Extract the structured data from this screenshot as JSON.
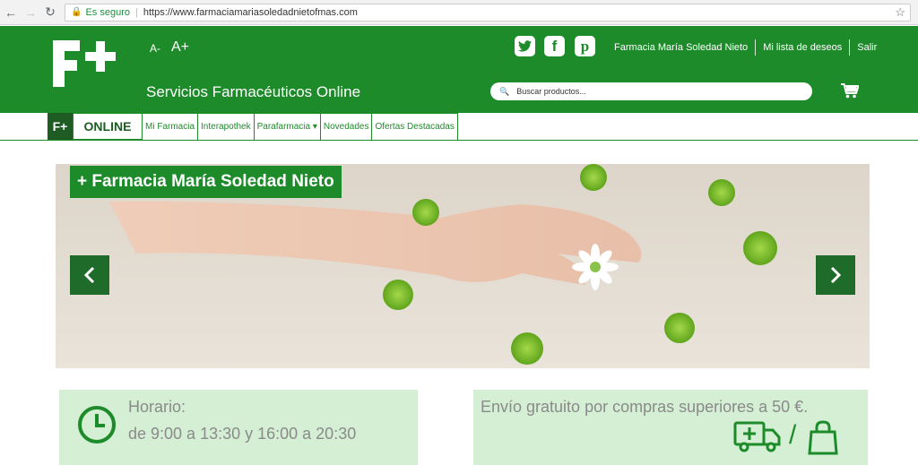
{
  "browser": {
    "secure_label": "Es seguro",
    "url": "https://www.farmaciamariasoledadnietofmas.com"
  },
  "header": {
    "logo_text": "F+",
    "font_decrease": "A-",
    "font_increase": "A+",
    "tagline": "Servicios Farmacéuticos Online",
    "links": [
      "Farmacia María Soledad Nieto",
      "Mi lista de deseos",
      "Salir"
    ],
    "search_placeholder": "Buscar productos...",
    "social_icons": [
      "twitter-icon",
      "facebook-icon",
      "pinterest-icon"
    ]
  },
  "nav": {
    "logo_text": "F+",
    "online_label": "ONLINE",
    "items": [
      "Mi Farmacia",
      "Interapothek",
      "Parafarmacia ▾",
      "Novedades",
      "Ofertas Destacadas"
    ]
  },
  "slider": {
    "label": "+ Farmacia María Soledad Nieto"
  },
  "info": {
    "horario_title": "Horario:",
    "horario_value": "de 9:00 a 13:30 y 16:00 a 20:30",
    "envio_text": "Envío gratuito por compras superiores a 50 €.",
    "slash": "/"
  },
  "colors": {
    "brand_green": "#1e8b2b",
    "dark_green": "#1e5c23",
    "box_green": "#d4efd4"
  }
}
